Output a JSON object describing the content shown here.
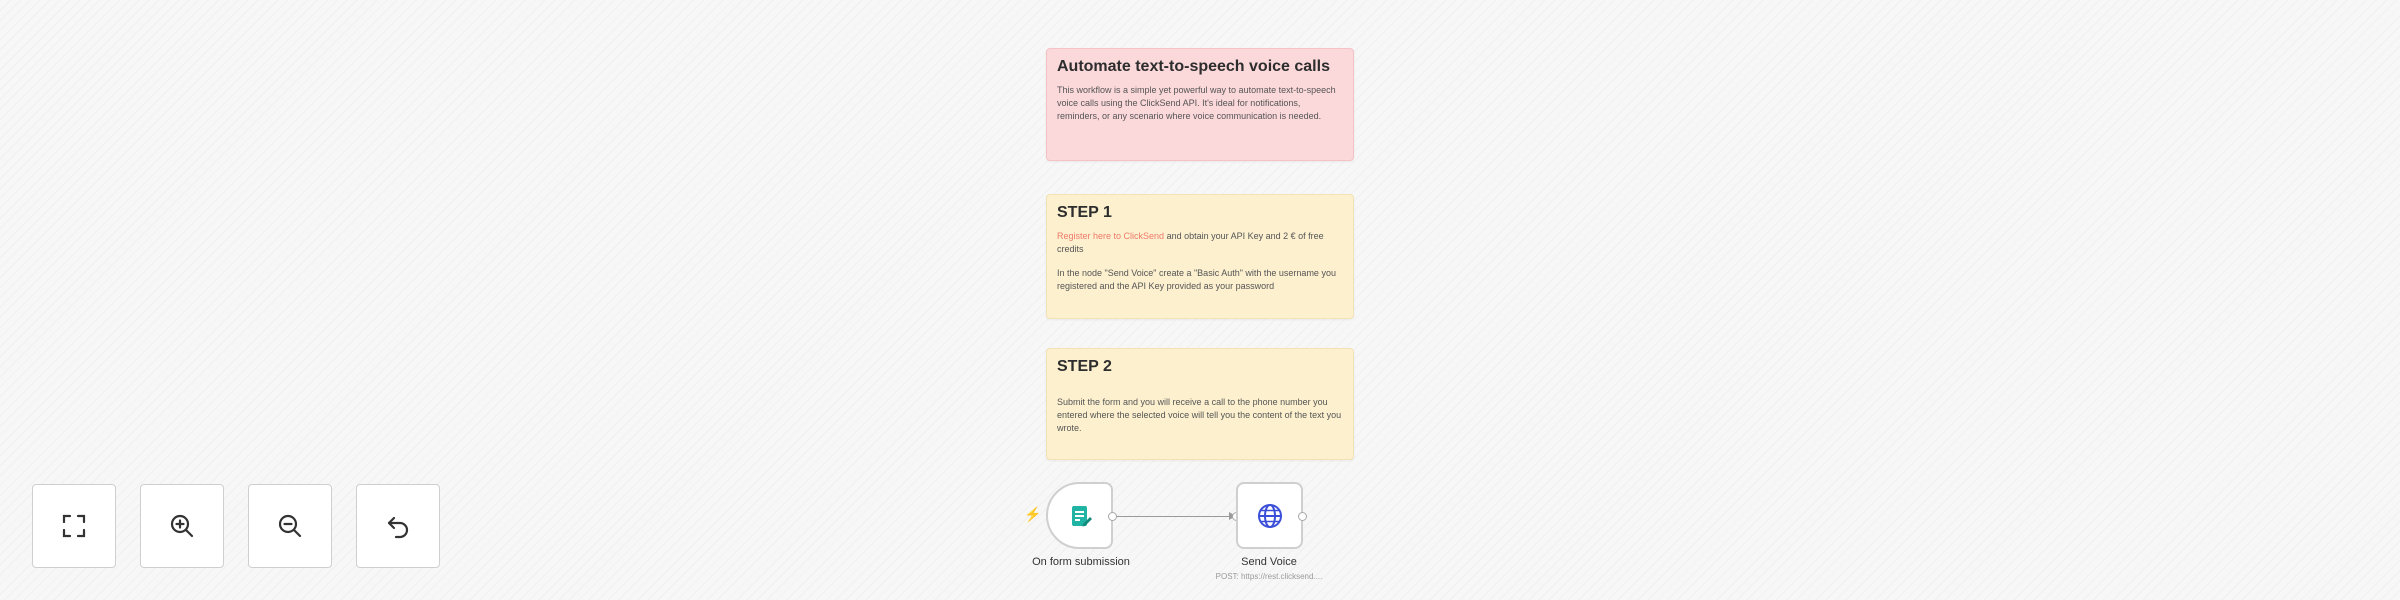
{
  "stickies": {
    "intro": {
      "title": "Automate text-to-speech voice calls",
      "body": "This workflow is a simple yet powerful way to automate text-to-speech voice calls using the ClickSend API. It's ideal for notifications, reminders, or any scenario where voice communication is needed."
    },
    "step1": {
      "title": "STEP 1",
      "link_text": "Register here to ClickSend",
      "body_after_link": " and obtain your API Key and 2 € of free credits",
      "body_2": "In the node \"Send Voice\" create a \"Basic Auth\" with the username you registered and the API Key provided as your password"
    },
    "step2": {
      "title": "STEP 2",
      "body": "Submit the form and you will receive a call to the phone number you entered where the selected voice will tell you the content of the text you wrote."
    }
  },
  "nodes": {
    "form_trigger": {
      "label": "On form submission",
      "icon": "form-icon"
    },
    "send_voice": {
      "label": "Send Voice",
      "subtitle": "POST: https://rest.clicksend....",
      "icon": "globe-icon"
    }
  },
  "controls": [
    {
      "name": "zoom-to-fit",
      "icon": "fit-view-icon"
    },
    {
      "name": "zoom-in",
      "icon": "zoom-in-icon"
    },
    {
      "name": "zoom-out",
      "icon": "zoom-out-icon"
    },
    {
      "name": "undo",
      "icon": "undo-icon"
    }
  ],
  "colors": {
    "sticky_red": "#fbd8da",
    "sticky_yellow": "#fcf0cf",
    "trigger_accent": "#ff6d5a",
    "form_icon": "#1fb4a3",
    "globe_icon": "#3b4fd8",
    "link": "#f07a6a"
  }
}
